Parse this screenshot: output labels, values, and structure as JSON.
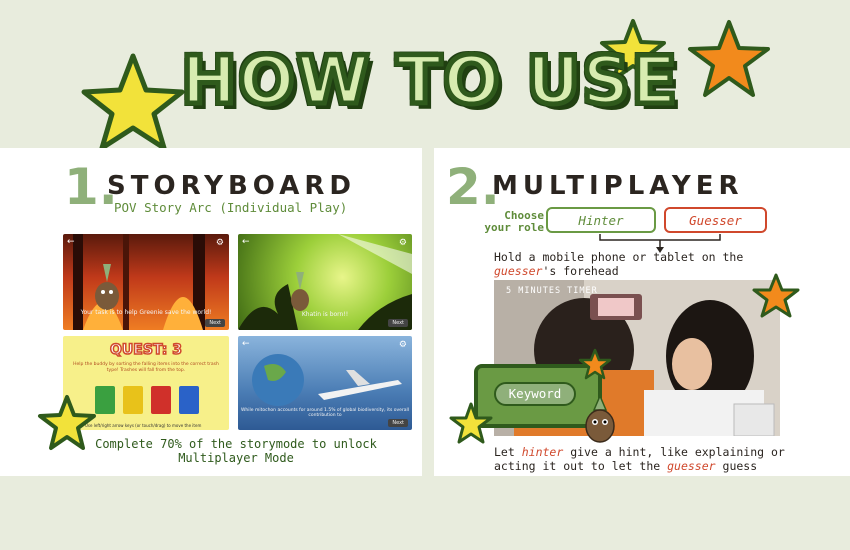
{
  "title": "HOW TO USE",
  "colors": {
    "accent_green": "#5f8c3a",
    "dark_green": "#2f5a1c",
    "hinter": "#6a9a44",
    "guesser": "#d0482c",
    "star_yellow": "#f2e23a",
    "star_orange": "#f28a1c"
  },
  "storyboard": {
    "number": "1.",
    "heading": "STORYBOARD",
    "subtitle": "POV Story Arc (Individual Play)",
    "shots": [
      {
        "caption": "Your task is to help Greenie save the world!",
        "next": "Next"
      },
      {
        "caption": "Khatin is born!!",
        "next": "Next"
      },
      {
        "banner": "QUEST: 3",
        "text": "Help the buddy by sorting the falling items into the correct trash type! Trashes will fall from the top.",
        "note": "Use left/right arrow keys (or touch/drag) to move the item"
      },
      {
        "caption": "While mitochon accounts for around 1.5% of global biodiversity, its overall contribution to",
        "next": "Next"
      }
    ],
    "footer": "Complete 70% of the storymode to unlock Multiplayer Mode"
  },
  "multiplayer": {
    "number": "2.",
    "heading": "MULTIPLAYER",
    "role_label_1": "Choose",
    "role_label_2": "your role",
    "hinter_label": "Hinter",
    "guesser_label": "Guesser",
    "instruction1_a": "Hold a mobile phone or tablet on the",
    "instruction1_b": "guesser",
    "instruction1_c": "'s forehead",
    "timer": "5 MINUTES TIMER",
    "keyword": "Keyword",
    "instruction2_a": "Let",
    "instruction2_b": "hinter",
    "instruction2_c": "give a hint, like explaining or",
    "instruction2_d": "acting it out to let the",
    "instruction2_e": "guesser",
    "instruction2_f": "guess"
  }
}
